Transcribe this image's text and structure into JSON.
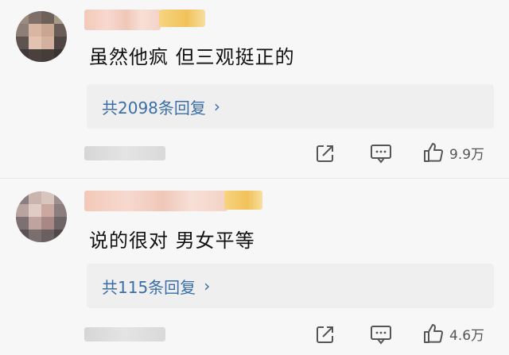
{
  "comments": [
    {
      "text": "虽然他疯 但三观挺正的",
      "reply_link": "共2098条回复",
      "like_count": "9.9万"
    },
    {
      "text": "说的很对 男女平等",
      "reply_link": "共115条回复",
      "like_count": "4.6万"
    }
  ],
  "icons": {
    "reply_chevron": "chevron-right-icon",
    "share": "share-icon",
    "comment": "comment-icon",
    "like": "thumbs-up-icon"
  },
  "colors": {
    "link": "#3b6ea8",
    "background": "#f7f7f7",
    "reply_box": "#efefef"
  }
}
